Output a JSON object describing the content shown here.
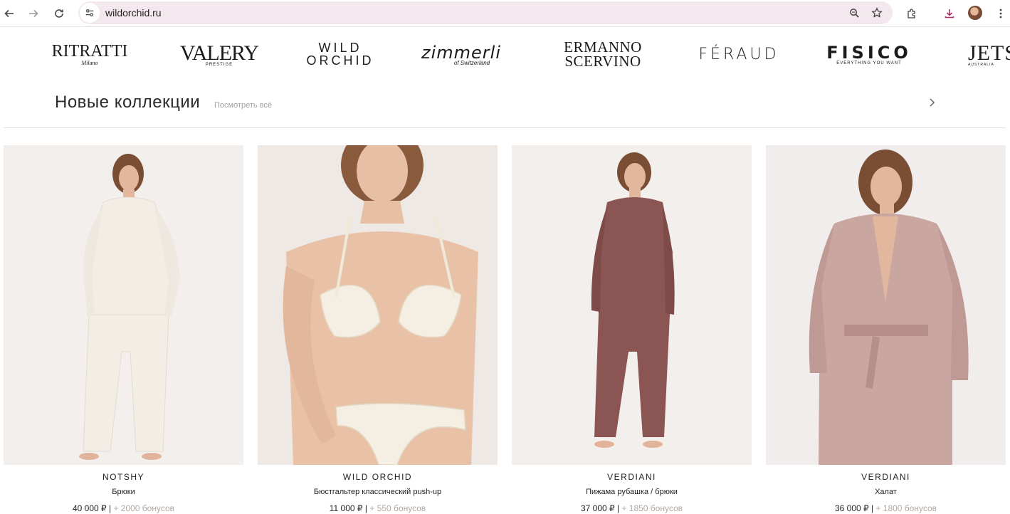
{
  "browser": {
    "url": "wildorchid.ru"
  },
  "brands": [
    {
      "name": "Ritratti",
      "main": "RITRATTI",
      "sub": "Milano"
    },
    {
      "name": "Valery",
      "main": "VALERY",
      "sub": "PRESTIGE"
    },
    {
      "name": "Wild Orchid",
      "main": "WILD",
      "main2": "ORCHID"
    },
    {
      "name": "Zimmerli",
      "main": "zimmerli",
      "sub": "of Switzerland"
    },
    {
      "name": "Ermanno Scervino",
      "main": "ERMANNO",
      "main2": "SCERVINO"
    },
    {
      "name": "Feraud",
      "main": "FÉRAUD"
    },
    {
      "name": "Fisico",
      "main": "FISICO",
      "sub": "EVERYTHING YOU WANT"
    },
    {
      "name": "Jets",
      "main": "JETS",
      "sub": "AUSTRALIA"
    }
  ],
  "section": {
    "title": "Новые коллекции",
    "view_all": "Посмотреть всё"
  },
  "products": [
    {
      "brand": "NOTSHY",
      "name": "Брюки",
      "price": "40 000 ₽",
      "sep": " | ",
      "bonus": "+ 2000 бонусов",
      "outfit_color": "#f3ede6"
    },
    {
      "brand": "WILD ORCHID",
      "name": "Бюстгальтер классический push-up",
      "price": "11 000 ₽",
      "sep": " | ",
      "bonus": "+ 550 бонусов",
      "outfit_color": "#f4efe2"
    },
    {
      "brand": "VERDIANI",
      "name": "Пижама рубашка / брюки",
      "price": "37 000 ₽",
      "sep": " | ",
      "bonus": "+ 1850 бонусов",
      "outfit_color": "#8a5552"
    },
    {
      "brand": "VERDIANI",
      "name": "Халат",
      "price": "36 000 ₽",
      "sep": " | ",
      "bonus": "+ 1800 бонусов",
      "outfit_color": "#c9a6a0"
    }
  ]
}
